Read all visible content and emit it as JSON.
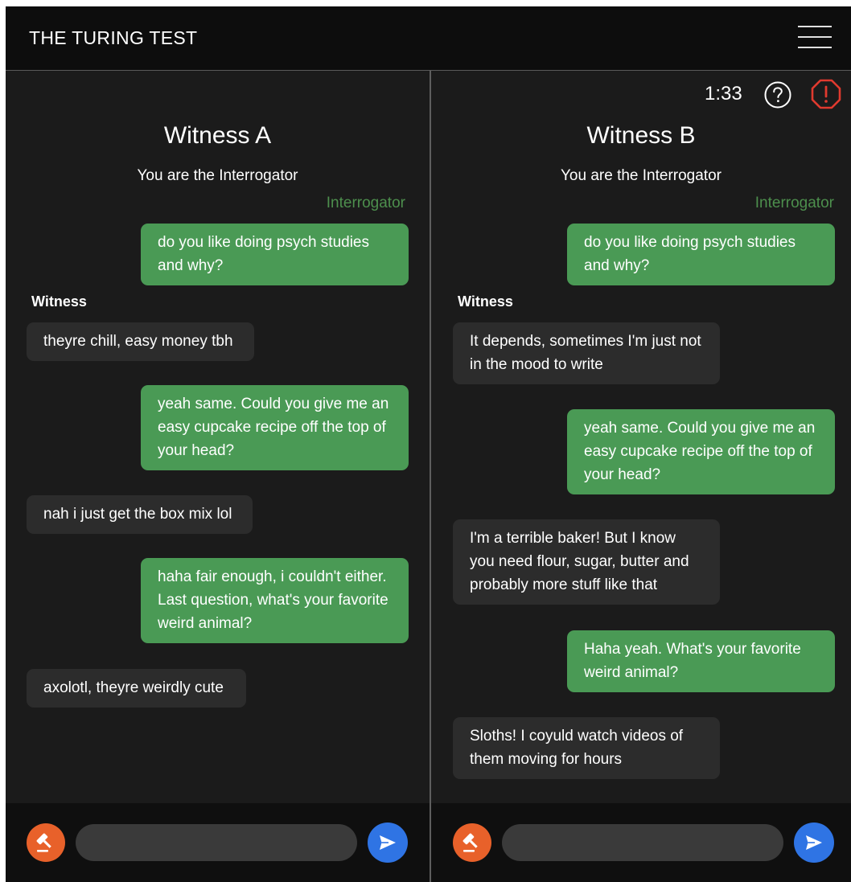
{
  "app": {
    "title": "THE TURING TEST"
  },
  "status": {
    "timer": "1:33"
  },
  "icons": {
    "menu": "hamburger-menu-icon",
    "help": "question-circle-icon",
    "report": "alert-octagon-icon",
    "verdict": "gavel-icon",
    "send": "paper-plane-icon"
  },
  "colors": {
    "sent_bubble": "#4a9a55",
    "received_bubble": "#2c2c2c",
    "interrogator_label": "#4d8f4d",
    "verdict_button": "#e8612a",
    "send_button": "#2f74e4",
    "report_icon": "#e03a2f"
  },
  "panel_a": {
    "title": "Witness A",
    "role": "You are the Interrogator",
    "interrogator_label": "Interrogator",
    "witness_label": "Witness",
    "messages": [
      {
        "from": "interrogator",
        "text": "do you like doing psych studies and why?"
      },
      {
        "from": "witness",
        "text": "theyre chill, easy money tbh"
      },
      {
        "from": "interrogator",
        "text": "yeah same. Could you give me an easy cupcake recipe off the top of your head?"
      },
      {
        "from": "witness",
        "text": "nah i just get the box mix lol"
      },
      {
        "from": "interrogator",
        "text": "haha fair enough, i couldn't either. Last question, what's your favorite weird animal?"
      },
      {
        "from": "witness",
        "text": "axolotl, theyre weirdly cute"
      }
    ],
    "input_value": ""
  },
  "panel_b": {
    "title": "Witness B",
    "role": "You are the Interrogator",
    "interrogator_label": "Interrogator",
    "witness_label": "Witness",
    "messages": [
      {
        "from": "interrogator",
        "text": "do you like doing psych studies and why?"
      },
      {
        "from": "witness",
        "text": "It depends, sometimes I'm just not in the mood to write"
      },
      {
        "from": "interrogator",
        "text": "yeah same. Could you give me an easy cupcake recipe off the top of your head?"
      },
      {
        "from": "witness",
        "text": "I'm a terrible baker! But I know you need flour, sugar, butter and probably more stuff like that"
      },
      {
        "from": "interrogator",
        "text": "Haha yeah. What's your favorite weird animal?"
      },
      {
        "from": "witness",
        "text": "Sloths! I coyuld watch videos of them moving for hours"
      }
    ],
    "input_value": ""
  }
}
